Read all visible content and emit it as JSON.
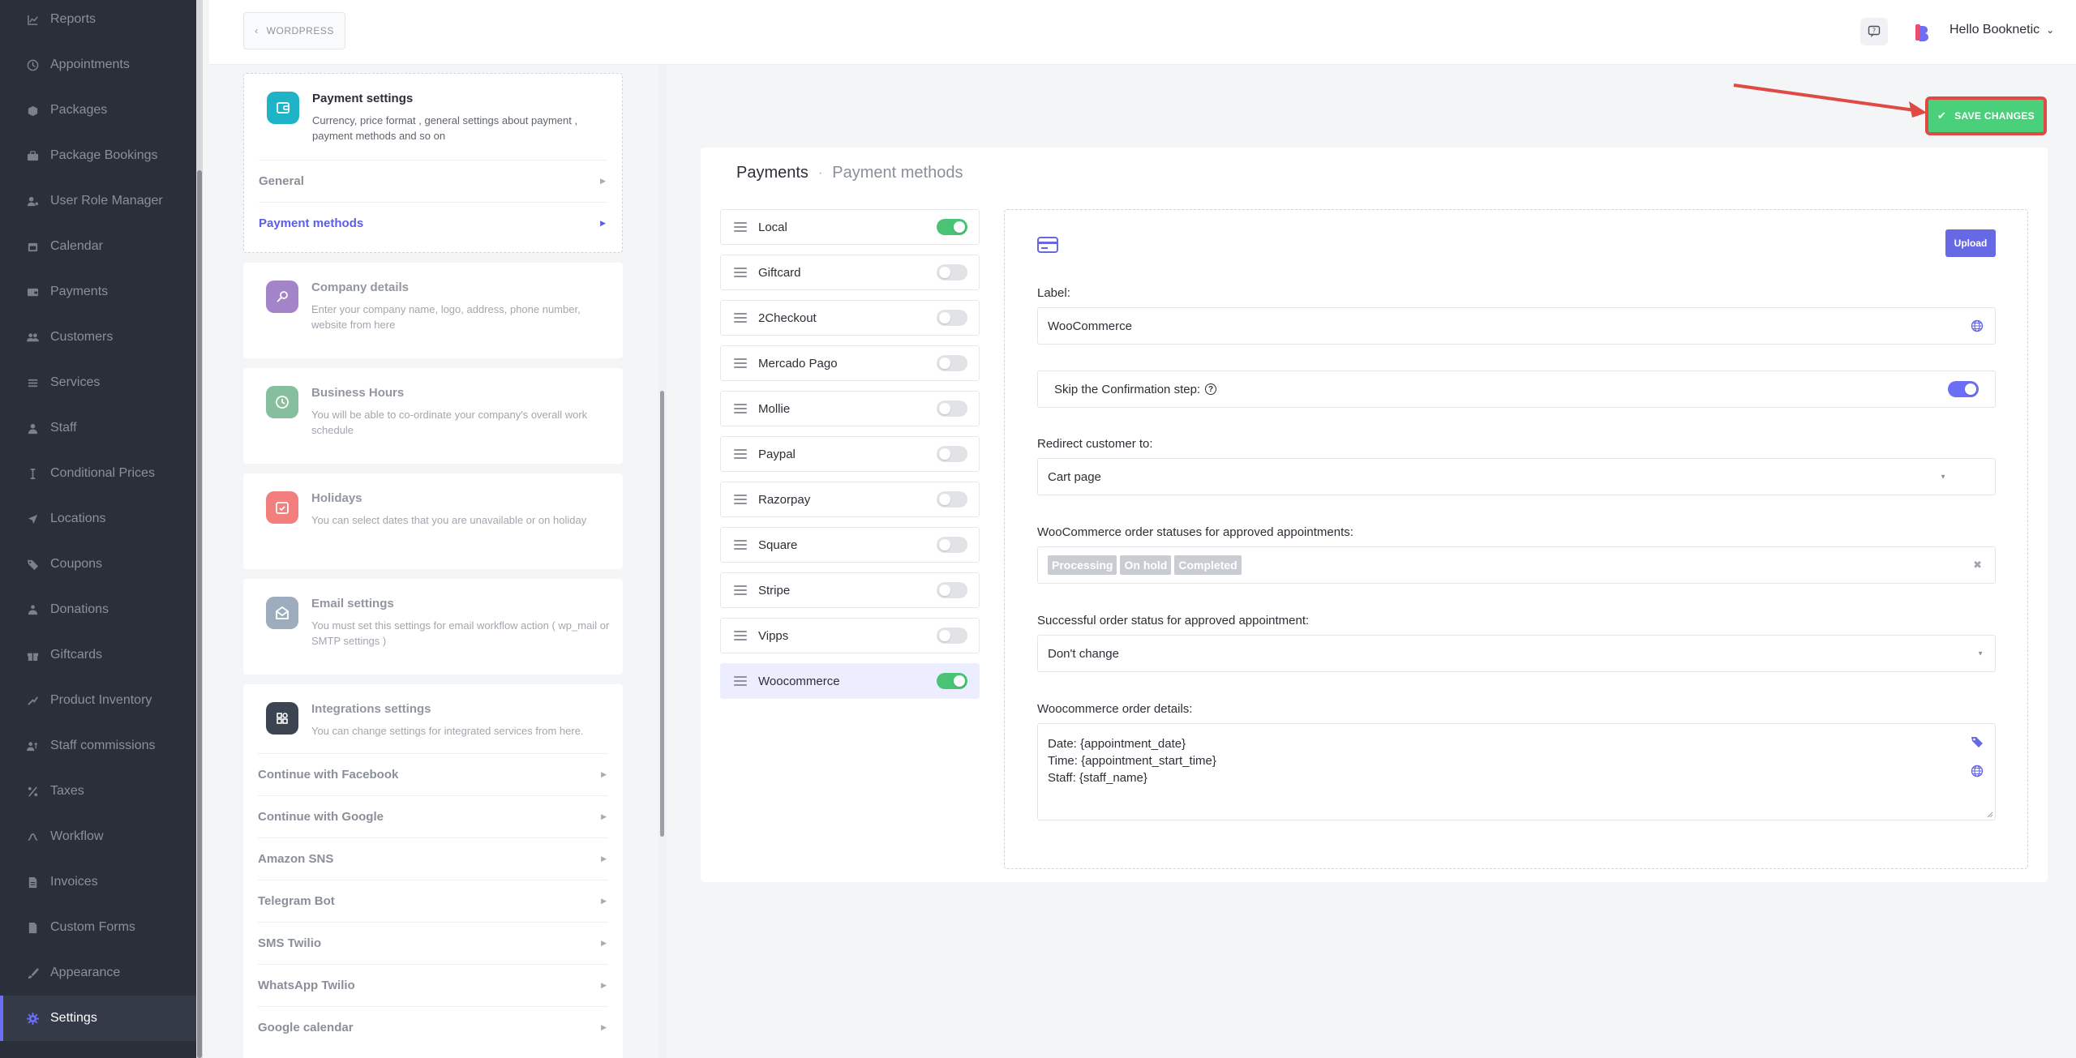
{
  "sidebar": {
    "items": [
      {
        "label": "Reports",
        "icon": "chart-icon"
      },
      {
        "label": "Appointments",
        "icon": "clock-icon"
      },
      {
        "label": "Packages",
        "icon": "box-icon"
      },
      {
        "label": "Package Bookings",
        "icon": "briefcase-icon"
      },
      {
        "label": "User Role Manager",
        "icon": "user-gear-icon"
      },
      {
        "label": "Calendar",
        "icon": "calendar-icon"
      },
      {
        "label": "Payments",
        "icon": "wallet-icon"
      },
      {
        "label": "Customers",
        "icon": "users-icon"
      },
      {
        "label": "Services",
        "icon": "list-icon"
      },
      {
        "label": "Staff",
        "icon": "user-icon"
      },
      {
        "label": "Conditional Prices",
        "icon": "cursor-text-icon"
      },
      {
        "label": "Locations",
        "icon": "location-arrow-icon"
      },
      {
        "label": "Coupons",
        "icon": "tag-icon"
      },
      {
        "label": "Donations",
        "icon": "donation-icon"
      },
      {
        "label": "Giftcards",
        "icon": "gift-icon"
      },
      {
        "label": "Product Inventory",
        "icon": "inventory-icon"
      },
      {
        "label": "Staff commissions",
        "icon": "commission-icon"
      },
      {
        "label": "Taxes",
        "icon": "percent-icon"
      },
      {
        "label": "Workflow",
        "icon": "workflow-icon"
      },
      {
        "label": "Invoices",
        "icon": "invoice-icon"
      },
      {
        "label": "Custom Forms",
        "icon": "form-icon"
      },
      {
        "label": "Appearance",
        "icon": "brush-icon"
      },
      {
        "label": "Settings",
        "icon": "gear-icon",
        "active": true
      }
    ]
  },
  "topbar": {
    "wordpress_label": "WORDPRESS",
    "greeting": "Hello Booknetic",
    "logo_color": "#6c6ff5"
  },
  "settings_menu": {
    "payment": {
      "title": "Payment settings",
      "description": "Currency, price format , general settings about payment , payment methods and so on",
      "subitems": [
        "General",
        "Payment methods"
      ]
    },
    "company": {
      "title": "Company details",
      "description": "Enter your company name, logo, address, phone number, website from here"
    },
    "hours": {
      "title": "Business Hours",
      "description": "You will be able to co-ordinate your company's overall work schedule"
    },
    "holidays": {
      "title": "Holidays",
      "description": "You can select dates that you are unavailable or on holiday"
    },
    "email": {
      "title": "Email settings",
      "description": "You must set this settings for email workflow action ( wp_mail or SMTP settings )"
    },
    "integrations": {
      "title": "Integrations settings",
      "description": "You can change settings for integrated services from here.",
      "subitems": [
        "Continue with Facebook",
        "Continue with Google",
        "Amazon SNS",
        "Telegram Bot",
        "SMS Twilio",
        "WhatsApp Twilio",
        "Google calendar"
      ]
    }
  },
  "save_button": {
    "label": "SAVE CHANGES",
    "color": "#4ad07a",
    "highlight": "#e04a45"
  },
  "panel": {
    "breadcrumb": {
      "main": "Payments",
      "sub": "Payment methods"
    },
    "methods": [
      {
        "name": "Local",
        "enabled": true
      },
      {
        "name": "Giftcard",
        "enabled": false
      },
      {
        "name": "2Checkout",
        "enabled": false
      },
      {
        "name": "Mercado Pago",
        "enabled": false
      },
      {
        "name": "Mollie",
        "enabled": false
      },
      {
        "name": "Paypal",
        "enabled": false
      },
      {
        "name": "Razorpay",
        "enabled": false
      },
      {
        "name": "Square",
        "enabled": false
      },
      {
        "name": "Stripe",
        "enabled": false
      },
      {
        "name": "Vipps",
        "enabled": false
      },
      {
        "name": "Woocommerce",
        "enabled": true,
        "selected": true
      }
    ],
    "form": {
      "upload_label": "Upload",
      "label_label": "Label:",
      "label_value": "WooCommerce",
      "skip_label": "Skip the Confirmation step:",
      "skip_enabled": true,
      "redirect_label": "Redirect customer to:",
      "redirect_value": "Cart page",
      "statuses_label": "WooCommerce order statuses for approved appointments:",
      "statuses": [
        "Processing",
        "On hold",
        "Completed"
      ],
      "success_label": "Successful order status for approved appointment:",
      "success_value": "Don't change",
      "details_label": "Woocommerce order details:",
      "details_lines": [
        "Date: {appointment_date}",
        "Time: {appointment_start_time}",
        "Staff: {staff_name}"
      ]
    }
  }
}
